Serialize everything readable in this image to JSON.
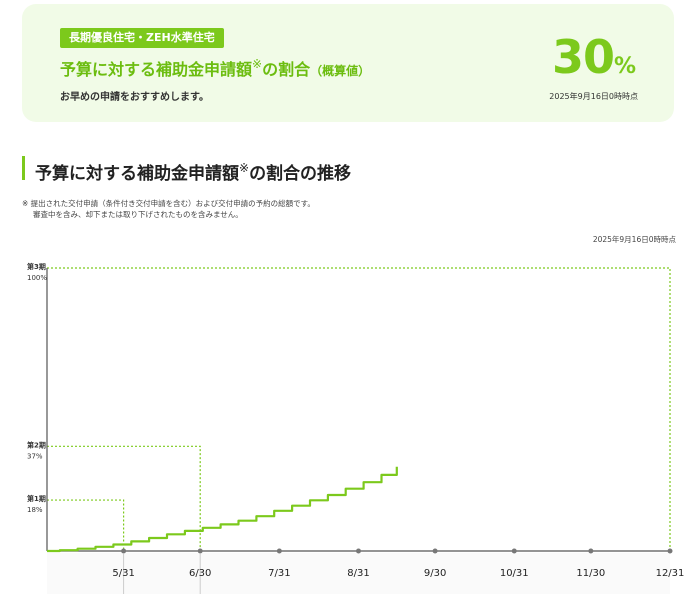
{
  "summary": {
    "badge": "長期優良住宅・ZEH水準住宅",
    "title_main": "予算に対する補助金申請額",
    "title_mark": "※",
    "title_rest": "の割合",
    "title_note": "（概算値）",
    "note": "お早めの申請をおすすめします。",
    "percent": "30",
    "percent_unit": "%",
    "date": "2025年9月16日0時時点"
  },
  "section": {
    "title_main": "予算に対する補助金申請額",
    "title_mark": "※",
    "title_rest": "の割合の推移",
    "footnote_1": "※  提出された交付申請（条件付き交付申請を含む）および交付申請の予約の総額です。",
    "footnote_2": "審査中を含み、却下または取り下げされたものを含みません。",
    "date": "2025年9月16日0時時点"
  },
  "colors": {
    "accent": "#7cc91c",
    "title": "#6cbd10",
    "background": "#f1fbe7"
  },
  "chart_data": {
    "type": "line",
    "x_type": "date",
    "x_ticks": [
      "5/31",
      "6/30",
      "7/31",
      "8/31",
      "9/30",
      "10/31",
      "11/30",
      "12/31"
    ],
    "x_tick_dates": [
      "2025-05-31",
      "2025-06-30",
      "2025-07-31",
      "2025-08-31",
      "2025-09-30",
      "2025-10-31",
      "2025-11-30",
      "2025-12-31"
    ],
    "ylim": [
      0,
      100
    ],
    "phases": [
      {
        "label": "第1期",
        "percent_label": "18%",
        "value": 18,
        "end": "2025-05-31"
      },
      {
        "label": "第2期",
        "percent_label": "37%",
        "value": 37,
        "end": "2025-06-30"
      },
      {
        "label": "第3期",
        "percent_label": "100%",
        "value": 100,
        "end": "2025-12-31"
      }
    ],
    "series": [
      {
        "x": [
          "2025-05-01",
          "2025-05-06",
          "2025-05-13",
          "2025-05-20",
          "2025-05-27",
          "2025-06-03",
          "2025-06-10",
          "2025-06-17",
          "2025-06-24",
          "2025-07-01",
          "2025-07-08",
          "2025-07-15",
          "2025-07-22",
          "2025-07-29",
          "2025-08-05",
          "2025-08-12",
          "2025-08-19",
          "2025-08-26",
          "2025-09-02",
          "2025-09-09",
          "2025-09-15"
        ],
        "y": [
          0,
          0.3,
          0.8,
          1.5,
          2.3,
          3.4,
          4.6,
          5.9,
          7.1,
          8.2,
          9.4,
          10.7,
          12.3,
          14.2,
          16.0,
          17.9,
          19.8,
          22.0,
          24.3,
          26.9,
          29.8
        ]
      }
    ]
  }
}
